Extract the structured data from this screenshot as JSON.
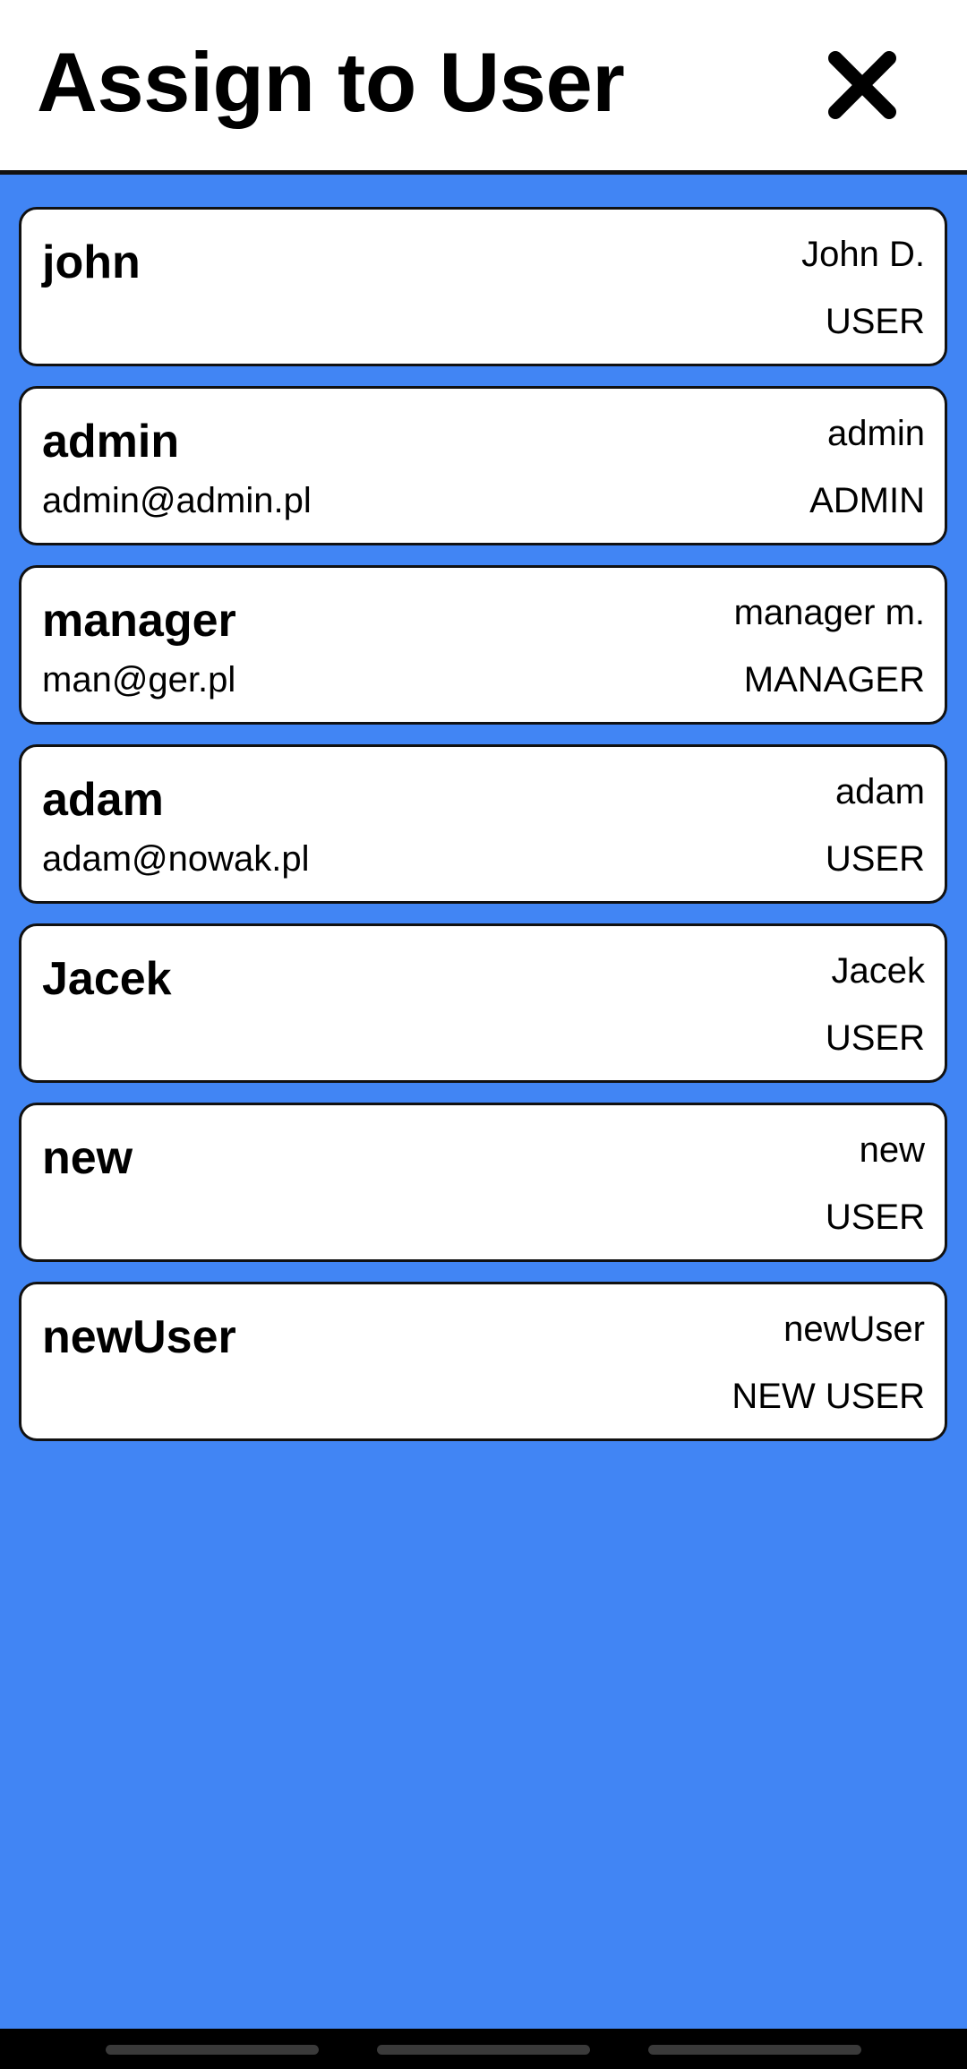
{
  "header": {
    "title": "Assign to User",
    "close_icon": "close-icon"
  },
  "users": [
    {
      "username": "john",
      "email": "",
      "full_name": "John D.",
      "role": "USER"
    },
    {
      "username": "admin",
      "email": "admin@admin.pl",
      "full_name": "admin",
      "role": "ADMIN"
    },
    {
      "username": "manager",
      "email": "man@ger.pl",
      "full_name": "manager m.",
      "role": "MANAGER"
    },
    {
      "username": "adam",
      "email": "adam@nowak.pl",
      "full_name": "adam",
      "role": "USER"
    },
    {
      "username": "Jacek",
      "email": "",
      "full_name": "Jacek",
      "role": "USER"
    },
    {
      "username": "new",
      "email": "",
      "full_name": "new",
      "role": "USER"
    },
    {
      "username": "newUser",
      "email": "",
      "full_name": "newUser",
      "role": "NEW USER"
    }
  ],
  "colors": {
    "background": "#4185f4",
    "card": "#ffffff",
    "text": "#000000",
    "navbar": "#000000"
  }
}
